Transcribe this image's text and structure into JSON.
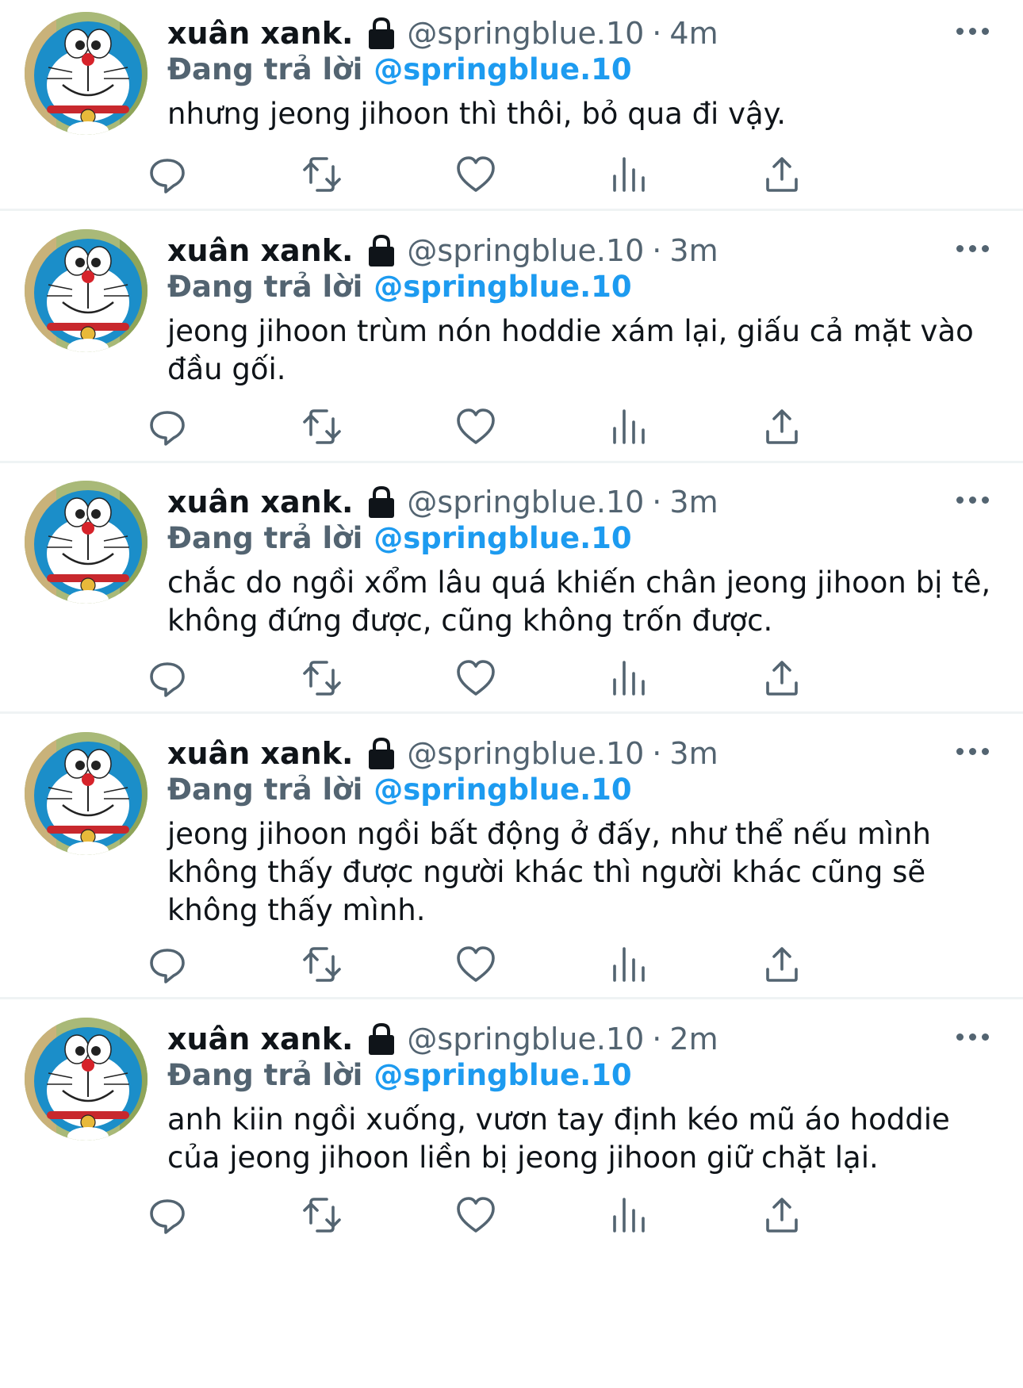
{
  "tweets": [
    {
      "display_name": "xuân xank.",
      "handle": "@springblue.10",
      "time": "4m",
      "reply_label": "Đang trả lời",
      "reply_to": "@springblue.10",
      "text": "nhưng jeong jihoon thì thôi, bỏ qua đi vậy."
    },
    {
      "display_name": "xuân xank.",
      "handle": "@springblue.10",
      "time": "3m",
      "reply_label": "Đang trả lời",
      "reply_to": "@springblue.10",
      "text": "jeong jihoon trùm nón hoddie xám lại, giấu cả mặt vào đầu gối."
    },
    {
      "display_name": "xuân xank.",
      "handle": "@springblue.10",
      "time": "3m",
      "reply_label": "Đang trả lời",
      "reply_to": "@springblue.10",
      "text": "chắc do ngồi xổm lâu quá khiến chân jeong jihoon bị tê, không đứng được, cũng không trốn được."
    },
    {
      "display_name": "xuân xank.",
      "handle": "@springblue.10",
      "time": "3m",
      "reply_label": "Đang trả lời",
      "reply_to": "@springblue.10",
      "text": "jeong jihoon ngồi bất động ở đấy, như thể nếu mình không thấy được người khác thì người khác cũng sẽ không thấy mình."
    },
    {
      "display_name": "xuân xank.",
      "handle": "@springblue.10",
      "time": "2m",
      "reply_label": "Đang trả lời",
      "reply_to": "@springblue.10",
      "text": "anh kiin ngồi xuống, vươn tay định kéo mũ áo hoddie của jeong jihoon liền bị jeong jihoon giữ chặt lại."
    }
  ],
  "separator": "·",
  "icons": {
    "lock": "lock-icon",
    "more": "more-icon",
    "reply": "reply-icon",
    "retweet": "retweet-icon",
    "like": "like-icon",
    "views": "views-icon",
    "share": "share-icon"
  },
  "colors": {
    "link": "#1d9bf0",
    "secondary": "#536471",
    "text": "#0f1419",
    "divider": "#eff3f4"
  }
}
